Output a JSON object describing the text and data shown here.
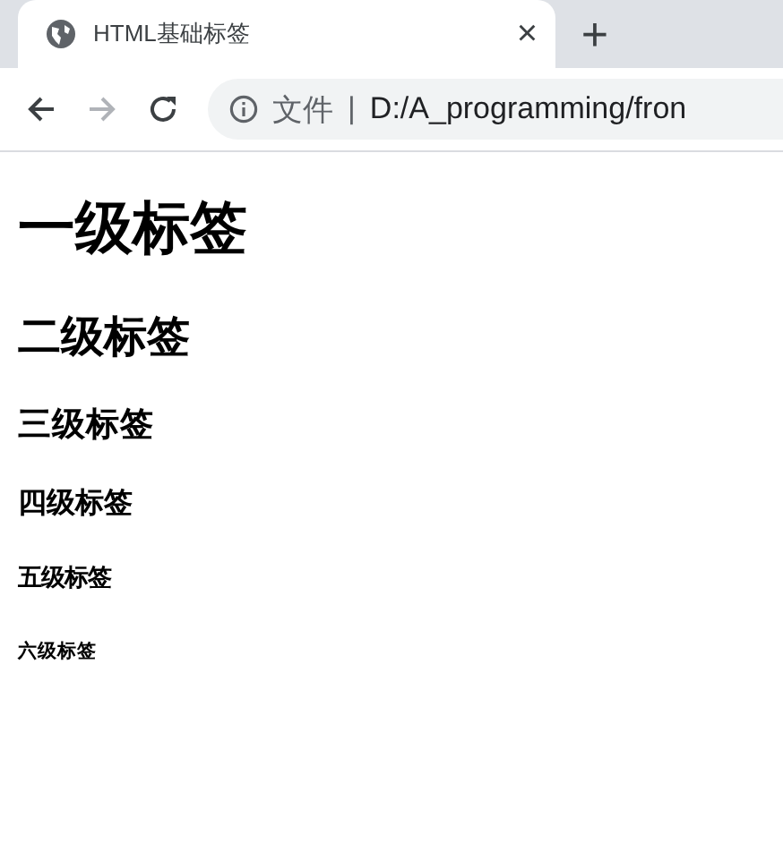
{
  "tab": {
    "title": "HTML基础标签",
    "close": "×",
    "new_tab": "+"
  },
  "toolbar": {
    "back": {
      "disabled": false
    },
    "forward": {
      "disabled": true
    },
    "address": {
      "scheme": "文件",
      "separator": "|",
      "url": "D:/A_programming/fron"
    }
  },
  "headings": [
    {
      "kind": "h1",
      "text": "一级标签"
    },
    {
      "kind": "h2",
      "text": "二级标签"
    },
    {
      "kind": "h3",
      "text": "三级标签"
    },
    {
      "kind": "h4",
      "text": "四级标签"
    },
    {
      "kind": "h5",
      "text": "五级标签"
    },
    {
      "kind": "h6",
      "text": "六级标签"
    }
  ]
}
